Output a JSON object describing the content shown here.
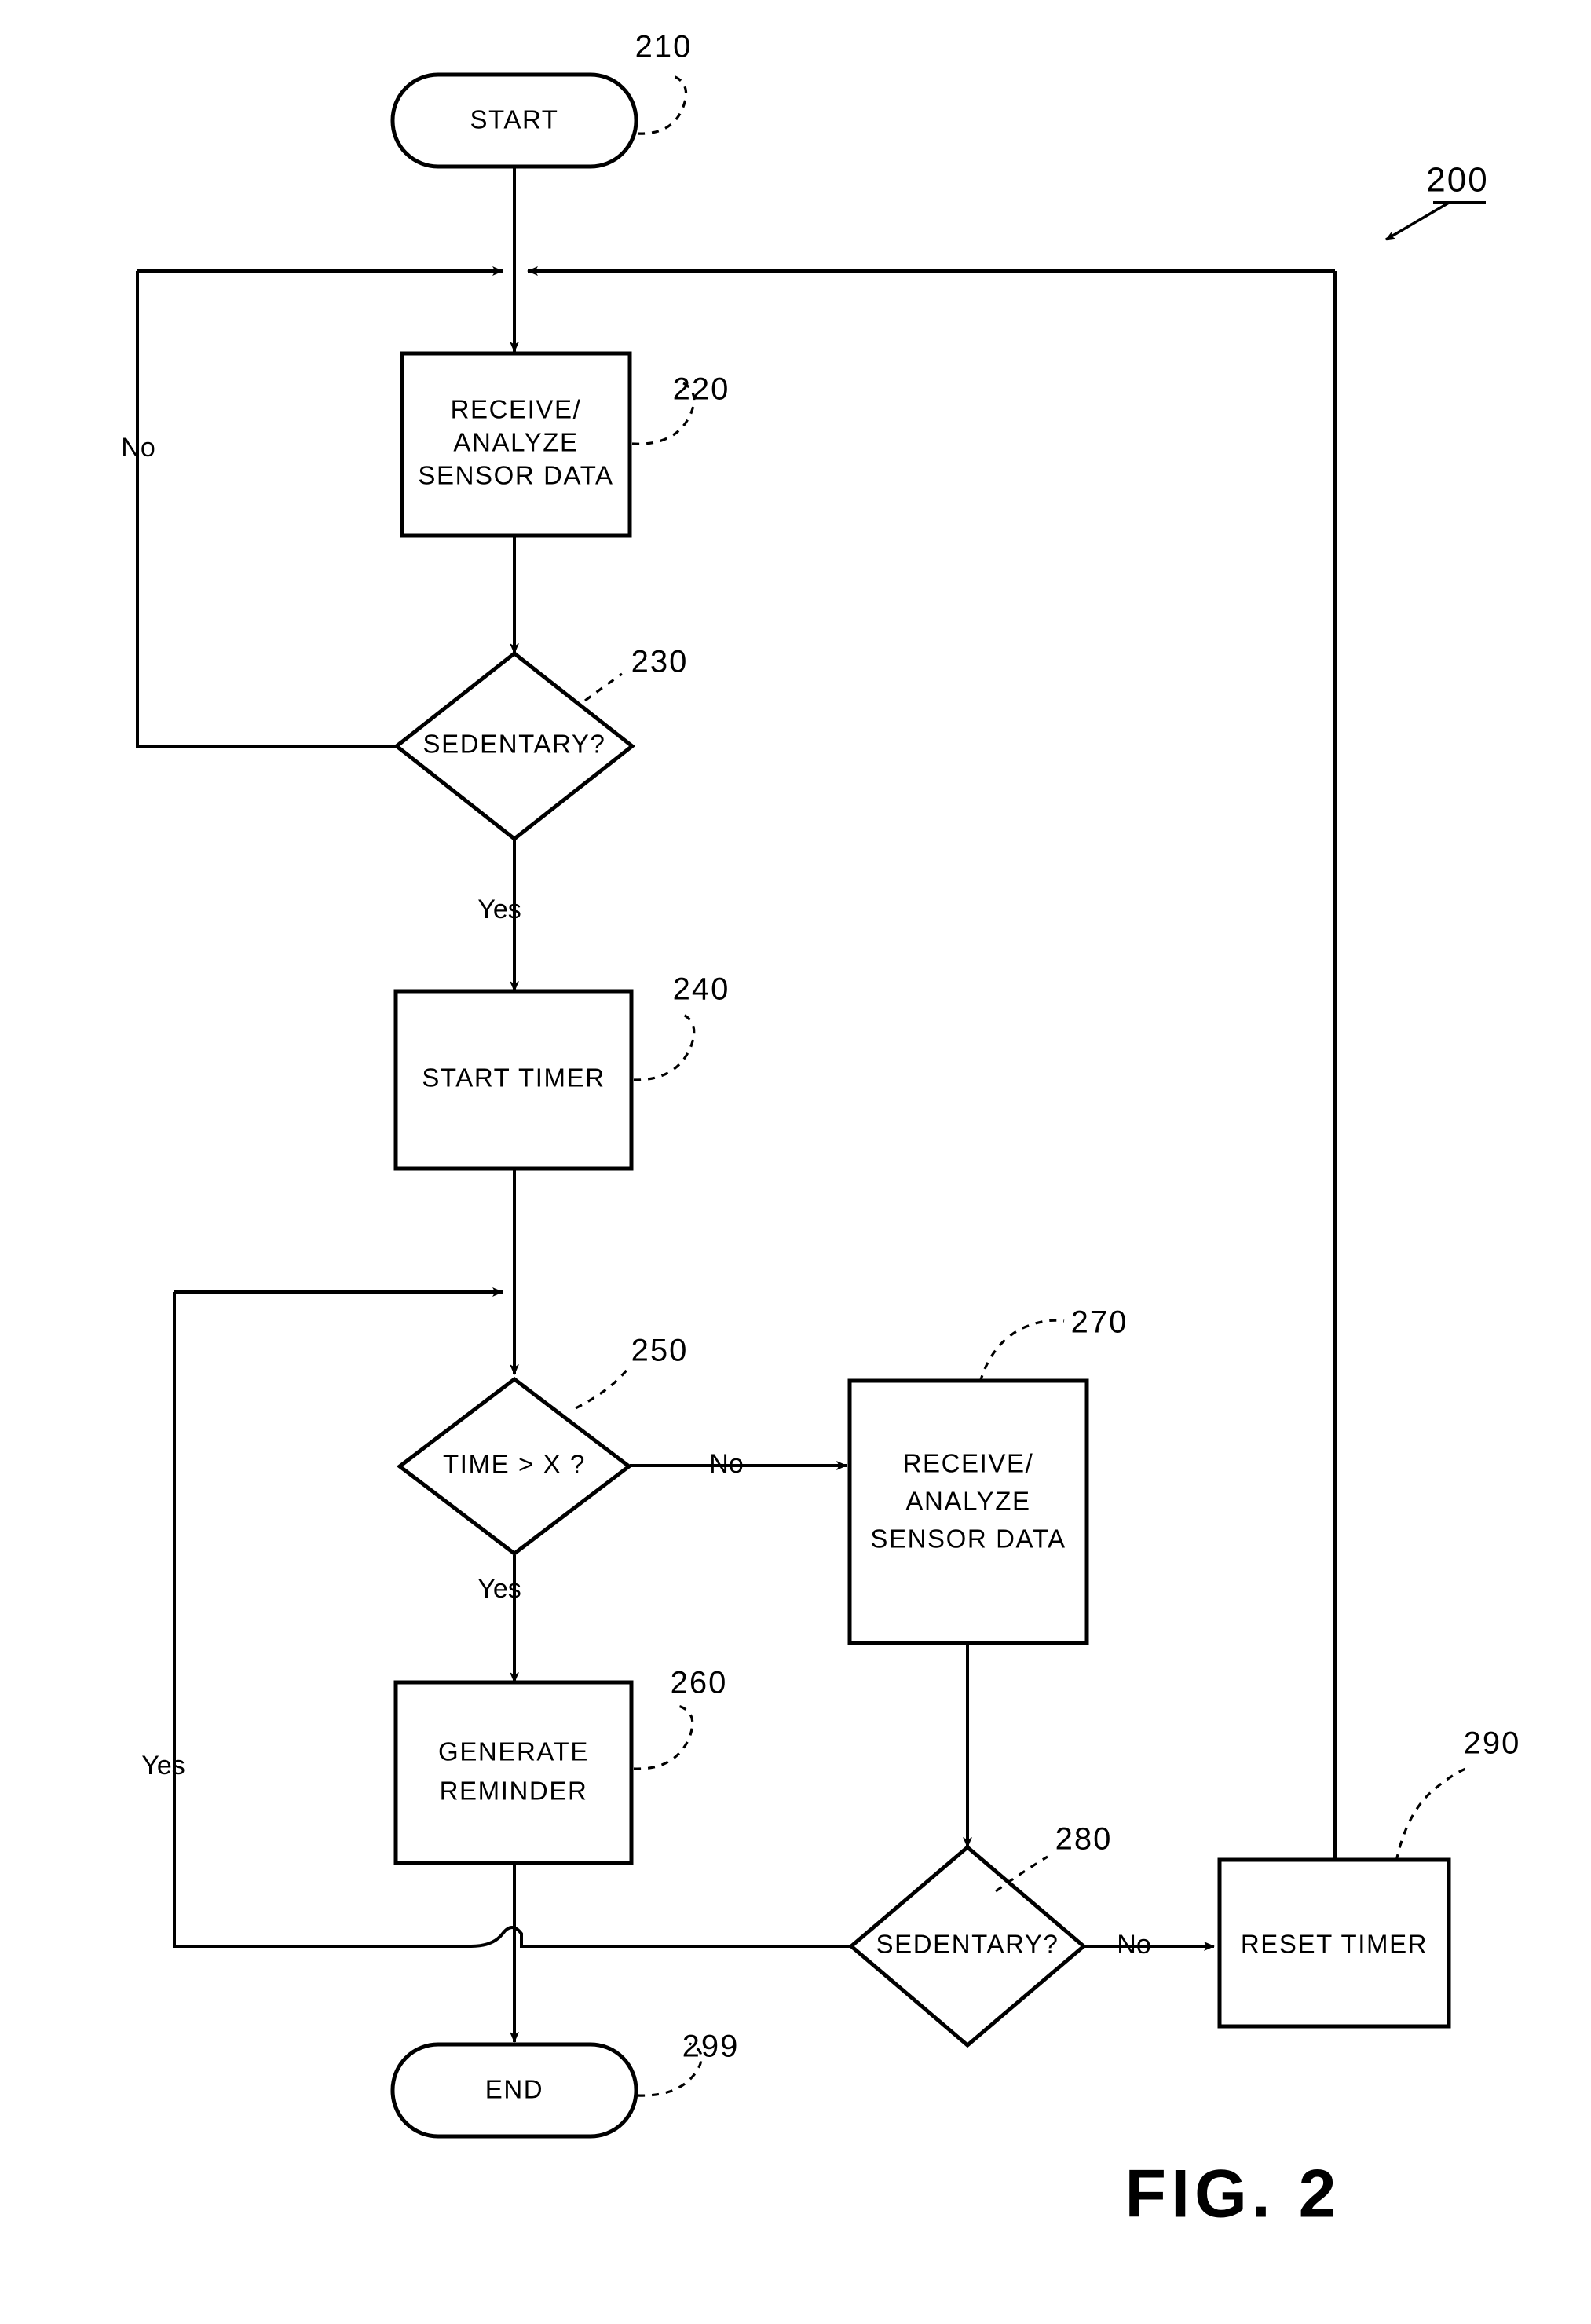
{
  "figure": {
    "caption": "FIG. 2",
    "diagram_ref": "200",
    "type": "flowchart"
  },
  "nodes": {
    "start": {
      "label": "START",
      "ref": "210",
      "shape": "terminator"
    },
    "receive_analyze_1": {
      "line1": "RECEIVE/",
      "line2": "ANALYZE",
      "line3": "SENSOR DATA",
      "ref": "220",
      "shape": "process"
    },
    "sedentary_1": {
      "label": "SEDENTARY?",
      "ref": "230",
      "shape": "decision"
    },
    "start_timer": {
      "label": "START TIMER",
      "ref": "240",
      "shape": "process"
    },
    "time_gt_x": {
      "label": "TIME > X ?",
      "ref": "250",
      "shape": "decision"
    },
    "generate_reminder": {
      "line1": "GENERATE",
      "line2": "REMINDER",
      "ref": "260",
      "shape": "process"
    },
    "receive_analyze_2": {
      "line1": "RECEIVE/",
      "line2": "ANALYZE",
      "line3": "SENSOR DATA",
      "ref": "270",
      "shape": "process"
    },
    "sedentary_2": {
      "label": "SEDENTARY?",
      "ref": "280",
      "shape": "decision"
    },
    "reset_timer": {
      "label": "RESET TIMER",
      "ref": "290",
      "shape": "process"
    },
    "end": {
      "label": "END",
      "ref": "299",
      "shape": "terminator"
    }
  },
  "edge_labels": {
    "sedentary1_no": "No",
    "sedentary1_yes": "Yes",
    "time_no": "No",
    "time_yes": "Yes",
    "sedentary2_no": "No",
    "sedentary2_yes": "Yes"
  },
  "colors": {
    "stroke": "#000000",
    "fill": "#ffffff",
    "background": "#ffffff"
  }
}
